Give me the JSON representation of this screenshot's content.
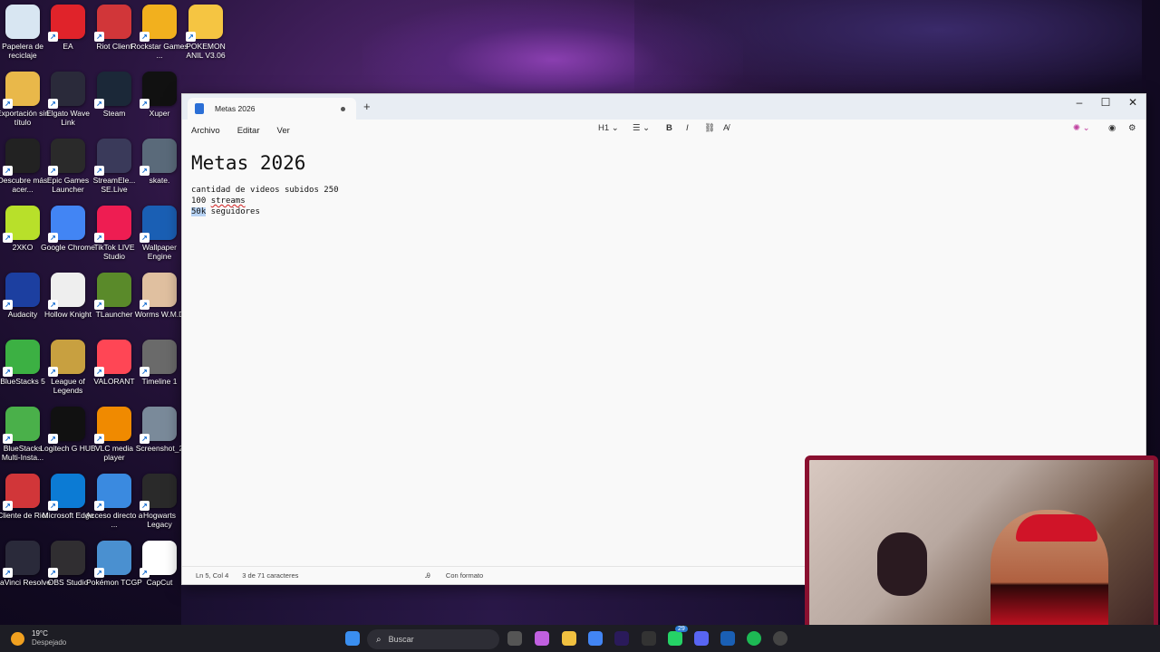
{
  "desktop_icons": [
    {
      "label": "Papelera de reciclaje",
      "color": "#d8e6f2"
    },
    {
      "label": "EA",
      "color": "#e0232a"
    },
    {
      "label": "Riot Client",
      "color": "#d13639"
    },
    {
      "label": "Rockstar Games ...",
      "color": "#f2b01e"
    },
    {
      "label": "POKEMON ANIL V3.06",
      "color": "#f5c542"
    },
    {
      "label": "Exportación sin título",
      "color": "#e9b84a"
    },
    {
      "label": "Elgato Wave Link",
      "color": "#2a2a3a"
    },
    {
      "label": "Steam",
      "color": "#1b2838"
    },
    {
      "label": "Xuper",
      "color": "#111111"
    },
    {
      "label": "Descubre más acer...",
      "color": "#222222"
    },
    {
      "label": "Epic Games Launcher",
      "color": "#2a2a2a"
    },
    {
      "label": "StreamEle... SE.Live",
      "color": "#3a3a5a"
    },
    {
      "label": "skate.",
      "color": "#5a6a7a"
    },
    {
      "label": "2XKO",
      "color": "#b8e02a"
    },
    {
      "label": "Google Chrome",
      "color": "#4285f4"
    },
    {
      "label": "TikTok LIVE Studio",
      "color": "#ee1d52"
    },
    {
      "label": "Wallpaper Engine",
      "color": "#1a5fb4"
    },
    {
      "label": "Audacity",
      "color": "#1c3fa0"
    },
    {
      "label": "Hollow Knight",
      "color": "#eeeeee"
    },
    {
      "label": "TLauncher",
      "color": "#5a8a2a"
    },
    {
      "label": "Worms W.M.D",
      "color": "#e0c0a0"
    },
    {
      "label": "BlueStacks 5",
      "color": "#3cb043"
    },
    {
      "label": "League of Legends",
      "color": "#c8a040"
    },
    {
      "label": "VALORANT",
      "color": "#ff4655"
    },
    {
      "label": "Timeline 1",
      "color": "#6a6a6a"
    },
    {
      "label": "BlueStacks Multi-Insta...",
      "color": "#4ab04a"
    },
    {
      "label": "Logitech G HUB",
      "color": "#111111"
    },
    {
      "label": "VLC media player",
      "color": "#f08a00"
    },
    {
      "label": "Screenshot_2",
      "color": "#7a8a9a"
    },
    {
      "label": "Cliente de Riot",
      "color": "#d13639"
    },
    {
      "label": "Microsoft Edge",
      "color": "#0c7bd4"
    },
    {
      "label": "Acceso directo a ...",
      "color": "#3a8ae0"
    },
    {
      "label": "Hogwarts Legacy",
      "color": "#2a2a2a"
    },
    {
      "label": "DaVinci Resolve",
      "color": "#2a2a3a"
    },
    {
      "label": "OBS Studio",
      "color": "#302e31"
    },
    {
      "label": "Pokémon TCGP",
      "color": "#4a90d0"
    },
    {
      "label": "CapCut",
      "color": "#ffffff"
    }
  ],
  "notepad": {
    "tab_title": "Metas 2026",
    "menu": [
      "Archivo",
      "Editar",
      "Ver"
    ],
    "heading_format": "H1",
    "document": {
      "heading": "Metas 2026",
      "line1": "cantidad de videos subidos 250",
      "line2_prefix": "100 ",
      "line2_word": "streams",
      "line3_selected": "50k",
      "line3_rest": " seguidores"
    },
    "status": {
      "position": "Ln 5, Col 4",
      "chars": "3 de 71 caracteres",
      "format": "Con formato"
    }
  },
  "taskbar": {
    "temperature": "19°C",
    "weather": "Despejado",
    "search_placeholder": "Buscar",
    "badge_count": "29"
  }
}
